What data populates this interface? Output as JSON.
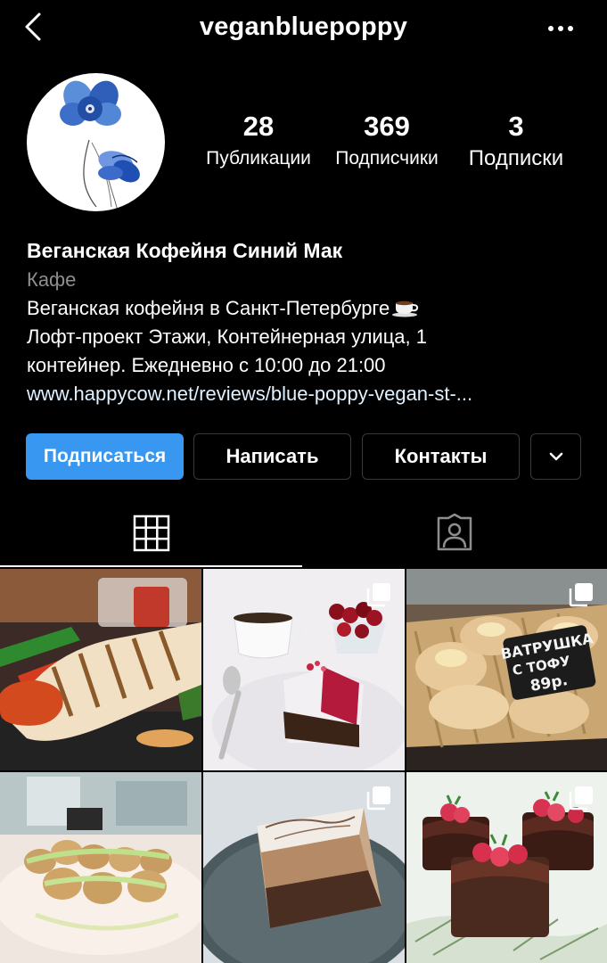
{
  "header": {
    "username": "veganbluepoppy",
    "back_icon": "chevron-left-icon",
    "more_icon": "more-horizontal-icon"
  },
  "profile": {
    "avatar": "blue-poppy-flower-logo",
    "stats": [
      {
        "value": "28",
        "label": "Публикации"
      },
      {
        "value": "369",
        "label": "Подписчики"
      },
      {
        "value": "3",
        "label": "Подписки"
      }
    ],
    "name": "Веганская Кофейня Синий Мак",
    "category": "Кафе",
    "bio_lines": [
      "Веганская кофейня в Санкт-Петербурге",
      "Лофт-проект Этажи, Контейнерная улица, 1",
      "контейнер. Ежедневно с 10:00 до 21:00"
    ],
    "bio_emoji": "coffee-cup-icon",
    "link": "www.happycow.net/reviews/blue-poppy-vegan-st-..."
  },
  "actions": {
    "follow": "Подписаться",
    "message": "Написать",
    "contacts": "Контакты",
    "more_icon": "chevron-down-icon"
  },
  "tabs": [
    {
      "name": "grid",
      "icon": "grid-icon",
      "active": true
    },
    {
      "name": "tagged",
      "icon": "tagged-person-icon",
      "active": false
    }
  ],
  "posts": [
    {
      "subject": "vegan hot dog",
      "multi": false
    },
    {
      "subject": "beet cake with cherries and coffee",
      "multi": true
    },
    {
      "subject": "tofu vatrushka pastries",
      "multi": true,
      "sign_lines": [
        "ВАТРУШКА",
        "С ТОФУ",
        "89р."
      ]
    },
    {
      "subject": "stuffed buns on plate",
      "multi": false
    },
    {
      "subject": "chocolate mousse cake slice",
      "multi": true
    },
    {
      "subject": "chocolate raspberry cakes",
      "multi": true
    }
  ],
  "colors": {
    "background": "#000000",
    "accent": "#3897f0",
    "secondary_text": "#8e8e8e",
    "link": "#e0f1ff"
  }
}
